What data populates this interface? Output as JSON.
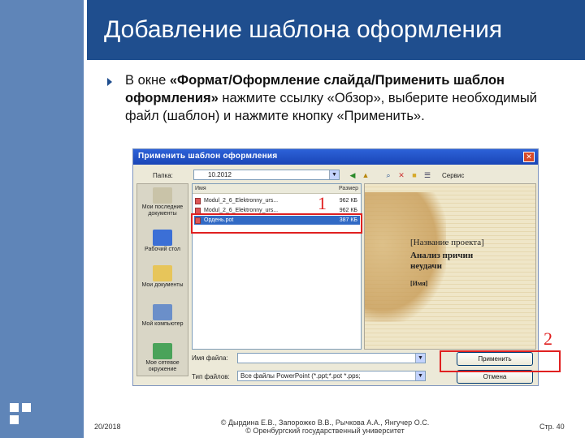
{
  "slide": {
    "title": "Добавление шаблона оформления",
    "bullet_bold_1": "«Формат/Оформление слайда/Применить шаблон оформления»",
    "bullet_pre": "В окне ",
    "bullet_rest": " нажмите ссылку «Обзор», выберите необходимый файл (шаблон) и нажмите кнопку «Применить»."
  },
  "dialog": {
    "title": "Применить шаблон оформления",
    "close_glyph": "✕",
    "folder_label": "Папка:",
    "folder_value": "10.2012",
    "tools_label": "Сервис",
    "places": [
      {
        "label": "Мои последние документы",
        "color": "#c9c3a8"
      },
      {
        "label": "Рабочий стол",
        "color": "#3b6fd6"
      },
      {
        "label": "Мои документы",
        "color": "#e7c55a"
      },
      {
        "label": "Мой компьютер",
        "color": "#6b8fc9"
      },
      {
        "label": "Мое сетевое окружение",
        "color": "#4aa35a"
      }
    ],
    "columns": {
      "name": "Имя",
      "size": "Размер"
    },
    "files": [
      {
        "name": "Modul_2_6_Elektronny_urs...",
        "size": "962 КБ",
        "selected": false
      },
      {
        "name": "Modul_2_6_Elektronny_urs...",
        "size": "962 КБ",
        "selected": false
      },
      {
        "name": "Ордень.pot",
        "size": "387 КБ",
        "selected": true
      }
    ],
    "preview": {
      "line1": "[Название проекта]",
      "line2": "Анализ причин неудачи",
      "line3": "[Имя]"
    },
    "filename_label": "Имя файла:",
    "filename_value": "",
    "filetype_label": "Тип файлов:",
    "filetype_value": "Все файлы PowerPoint (*.ppt;*.pot *.pps;",
    "apply_button": "Применить",
    "cancel_button": "Отмена"
  },
  "annotations": {
    "marker1": "1",
    "marker2": "2"
  },
  "footer": {
    "date": "20/2018",
    "copyright_line1": "© Дырдина Е.В., Запорожко В.В., Рычкова А.А., Янгучер О.С.",
    "copyright_line2": "© Оренбургский государственный университет",
    "page": "Стр. 40"
  },
  "colors": {
    "accent": "#1f4e8e",
    "band": "#5f85b8",
    "highlight": "#e02020"
  }
}
